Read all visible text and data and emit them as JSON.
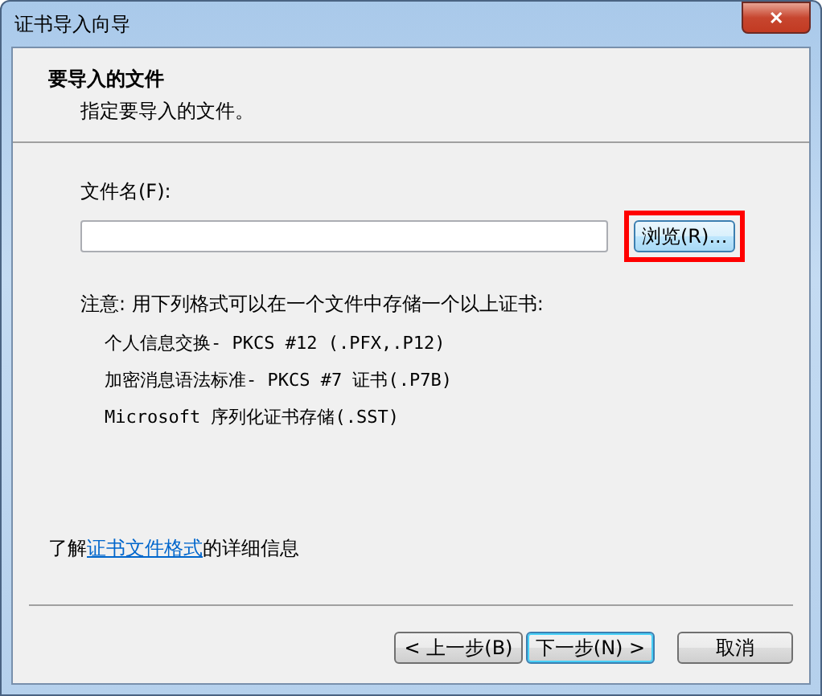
{
  "window": {
    "title": "证书导入向导",
    "close": "✕"
  },
  "header": {
    "title": "要导入的文件",
    "subtitle": "指定要导入的文件。"
  },
  "file_field": {
    "label": "文件名(F):"
  },
  "browse_button": {
    "label": "浏览(R)...",
    "highlighted": true
  },
  "note": {
    "text": "注意: 用下列格式可以在一个文件中存储一个以上证书:",
    "formats": [
      "个人信息交换- PKCS #12 (.PFX,.P12)",
      "加密消息语法标准- PKCS #7 证书(.P7B)",
      "Microsoft 序列化证书存储(.SST)"
    ]
  },
  "info": {
    "before": "了解",
    "link": "证书文件格式",
    "after": "的详细信息"
  },
  "buttons": [
    {
      "label": "< 上一步(B)",
      "default": false
    },
    {
      "label": "下一步(N) >",
      "default": true
    },
    {
      "label": "取消",
      "default": false
    }
  ]
}
